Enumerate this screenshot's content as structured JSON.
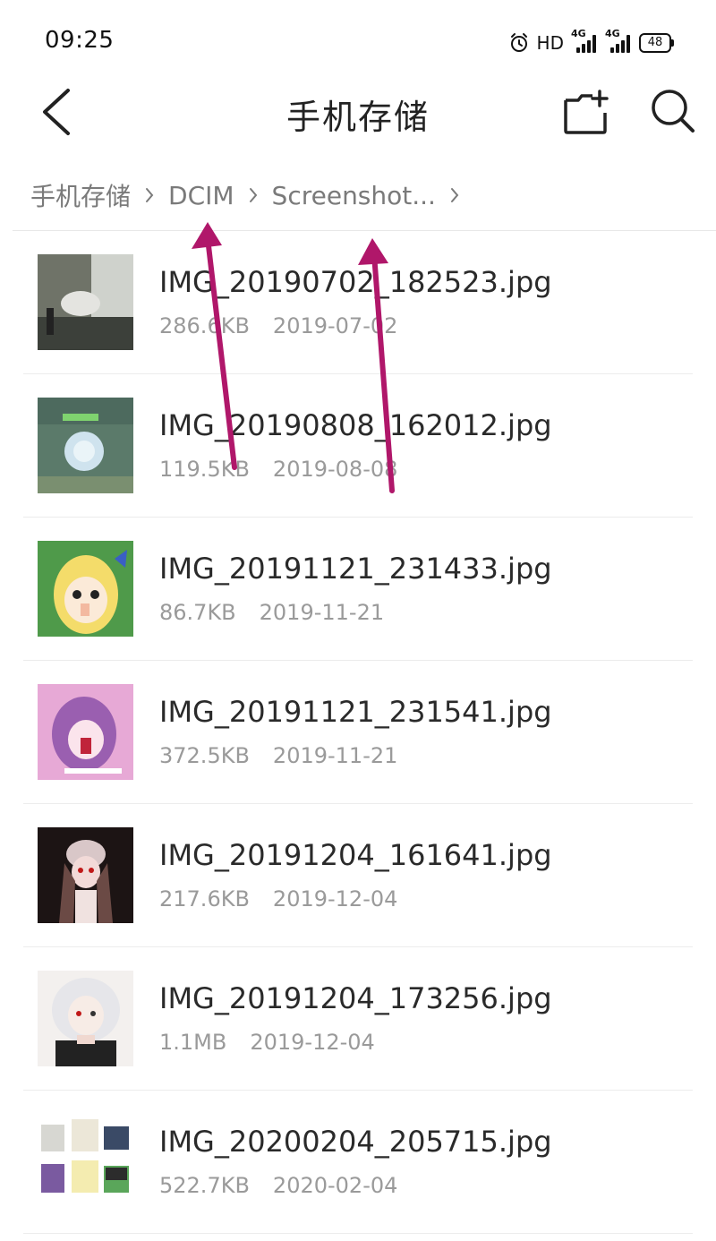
{
  "status_bar": {
    "time": "09:25",
    "hd_label": "HD",
    "signal_1_label": "4G",
    "signal_2_label": "4G",
    "battery": "48",
    "alarm_icon": "alarm-clock-icon"
  },
  "header": {
    "title": "手机存储",
    "back_icon": "chevron-left-icon",
    "new_folder_icon": "new-folder-icon",
    "search_icon": "search-icon"
  },
  "breadcrumb": {
    "items": [
      "手机存储",
      "DCIM",
      "Screenshot..."
    ]
  },
  "files": [
    {
      "name": "IMG_20190702_182523.jpg",
      "size": "286.6KB",
      "date": "2019-07-02"
    },
    {
      "name": "IMG_20190808_162012.jpg",
      "size": "119.5KB",
      "date": "2019-08-08"
    },
    {
      "name": "IMG_20191121_231433.jpg",
      "size": "86.7KB",
      "date": "2019-11-21"
    },
    {
      "name": "IMG_20191121_231541.jpg",
      "size": "372.5KB",
      "date": "2019-11-21"
    },
    {
      "name": "IMG_20191204_161641.jpg",
      "size": "217.6KB",
      "date": "2019-12-04"
    },
    {
      "name": "IMG_20191204_173256.jpg",
      "size": "1.1MB",
      "date": "2019-12-04"
    },
    {
      "name": "IMG_20200204_205715.jpg",
      "size": "522.7KB",
      "date": "2020-02-04"
    }
  ],
  "colors": {
    "accent_arrow": "#b0176a",
    "breadcrumb_text": "#7a7a7a",
    "meta_text": "#9a9a9a"
  }
}
